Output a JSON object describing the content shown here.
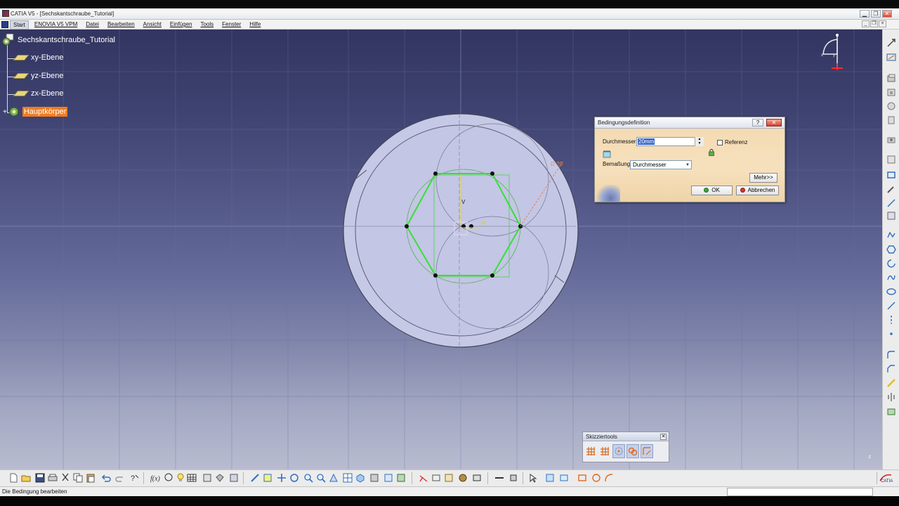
{
  "window": {
    "title": "CATIA V5 - [Sechskantschraube_Tutorial]",
    "minimize": "▁",
    "maximize": "❐",
    "close": "✕"
  },
  "menu": {
    "items": [
      "Start",
      "ENOVIA V5 VPM",
      "Datei",
      "Bearbeiten",
      "Ansicht",
      "Einfügen",
      "Tools",
      "Fenster",
      "Hilfe"
    ],
    "active_index": 0
  },
  "tree": {
    "root": "Sechskantschraube_Tutorial",
    "nodes": [
      {
        "label": "xy-Ebene",
        "icon": "plane-icon"
      },
      {
        "label": "yz-Ebene",
        "icon": "plane-icon"
      },
      {
        "label": "zx-Ebene",
        "icon": "plane-icon"
      },
      {
        "label": "Hauptkörper",
        "icon": "body-gear-icon",
        "selected": true
      }
    ]
  },
  "sketch": {
    "dimension_label": "D 20",
    "v_axis_label": "V",
    "h_axis_label": "H"
  },
  "dialog": {
    "title": "Bedingungsdefinition",
    "help": "?",
    "close": "✕",
    "diameter_label": "Durchmesser",
    "diameter_value": "20mm",
    "reference_label": "Referenz",
    "reference_checked": false,
    "dimensioning_label": "Bemaßung",
    "dimensioning_value": "Durchmesser",
    "more_button": "Mehr>>",
    "ok_button": "OK",
    "cancel_button": "Abbrechen"
  },
  "sketch_tools": {
    "title": "Skizziertools",
    "close": "✕",
    "icons": [
      "grid-icon",
      "snap-to-point-icon",
      "construction-element-icon",
      "geometric-constraints-icon",
      "dimensional-constraints-icon"
    ]
  },
  "compass": {
    "x_label": "x",
    "y_label": "y"
  },
  "z_axis_label": "z",
  "status": {
    "message": "Die Bedingung bearbeiten"
  },
  "colors": {
    "selection": "#f07c1e",
    "sketch_green": "#36e036",
    "dialog_bg": "#f6e0bd",
    "viewport_top": "#323560",
    "viewport_bottom": "#b9bcd0"
  }
}
